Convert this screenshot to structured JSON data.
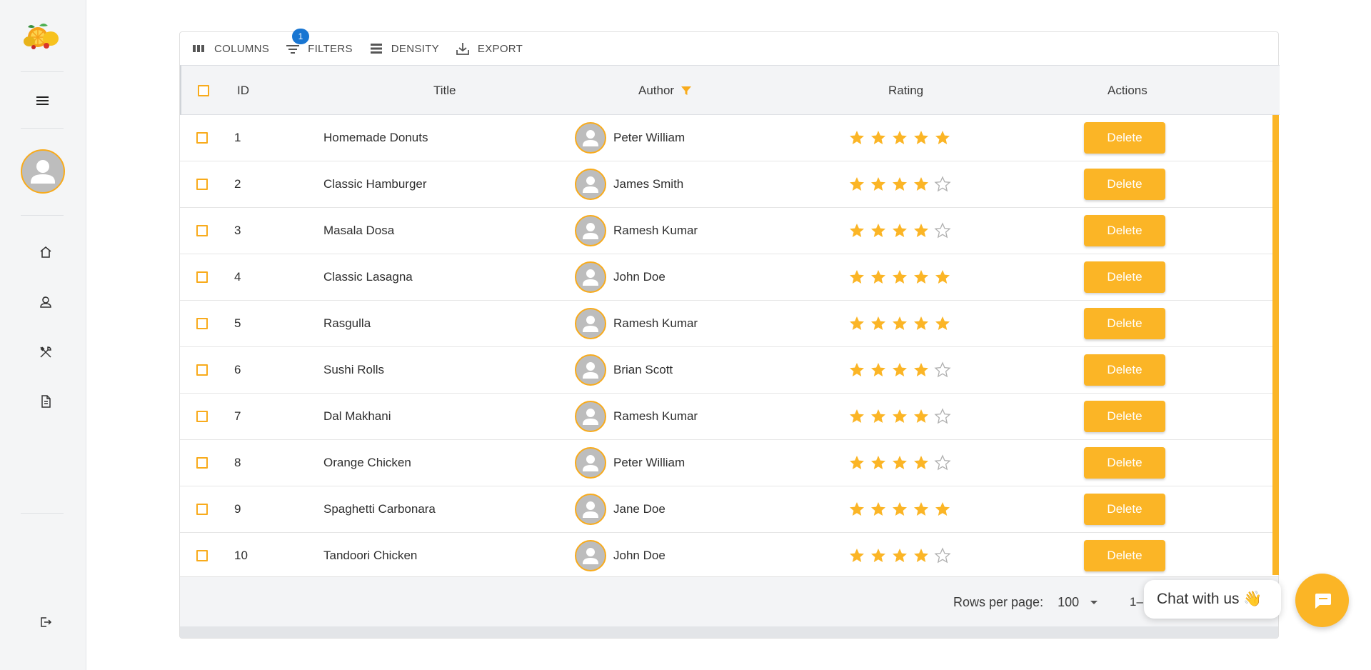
{
  "toolbar": {
    "columns_label": "COLUMNS",
    "filters_label": "FILTERS",
    "filters_badge": "1",
    "density_label": "DENSITY",
    "export_label": "EXPORT"
  },
  "columns": {
    "id": "ID",
    "title": "Title",
    "author": "Author",
    "rating": "Rating",
    "actions": "Actions"
  },
  "rows": [
    {
      "id": "1",
      "title": "Homemade Donuts",
      "author": "Peter William",
      "rating": 5,
      "action": "Delete"
    },
    {
      "id": "2",
      "title": "Classic Hamburger",
      "author": "James Smith",
      "rating": 4,
      "action": "Delete"
    },
    {
      "id": "3",
      "title": "Masala Dosa",
      "author": "Ramesh Kumar",
      "rating": 4,
      "action": "Delete"
    },
    {
      "id": "4",
      "title": "Classic Lasagna",
      "author": "John Doe",
      "rating": 5,
      "action": "Delete"
    },
    {
      "id": "5",
      "title": "Rasgulla",
      "author": "Ramesh Kumar",
      "rating": 5,
      "action": "Delete"
    },
    {
      "id": "6",
      "title": "Sushi Rolls",
      "author": "Brian Scott",
      "rating": 4,
      "action": "Delete"
    },
    {
      "id": "7",
      "title": "Dal Makhani",
      "author": "Ramesh Kumar",
      "rating": 4,
      "action": "Delete"
    },
    {
      "id": "8",
      "title": "Orange Chicken",
      "author": "Peter William",
      "rating": 4,
      "action": "Delete"
    },
    {
      "id": "9",
      "title": "Spaghetti Carbonara",
      "author": "Jane Doe",
      "rating": 5,
      "action": "Delete"
    },
    {
      "id": "10",
      "title": "Tandoori Chicken",
      "author": "John Doe",
      "rating": 4,
      "action": "Delete"
    }
  ],
  "footer": {
    "rows_per_page_label": "Rows per page:",
    "rows_per_page_value": "100",
    "range_text": "1–1"
  },
  "chat": {
    "label": "Chat with us 👋"
  },
  "colors": {
    "accent": "#fbb526",
    "badge": "#1976d2"
  },
  "icons": {
    "sidebar": [
      "hamburger-menu-icon",
      "home-icon",
      "users-icon",
      "utensils-icon",
      "document-icon",
      "logout-icon"
    ]
  }
}
